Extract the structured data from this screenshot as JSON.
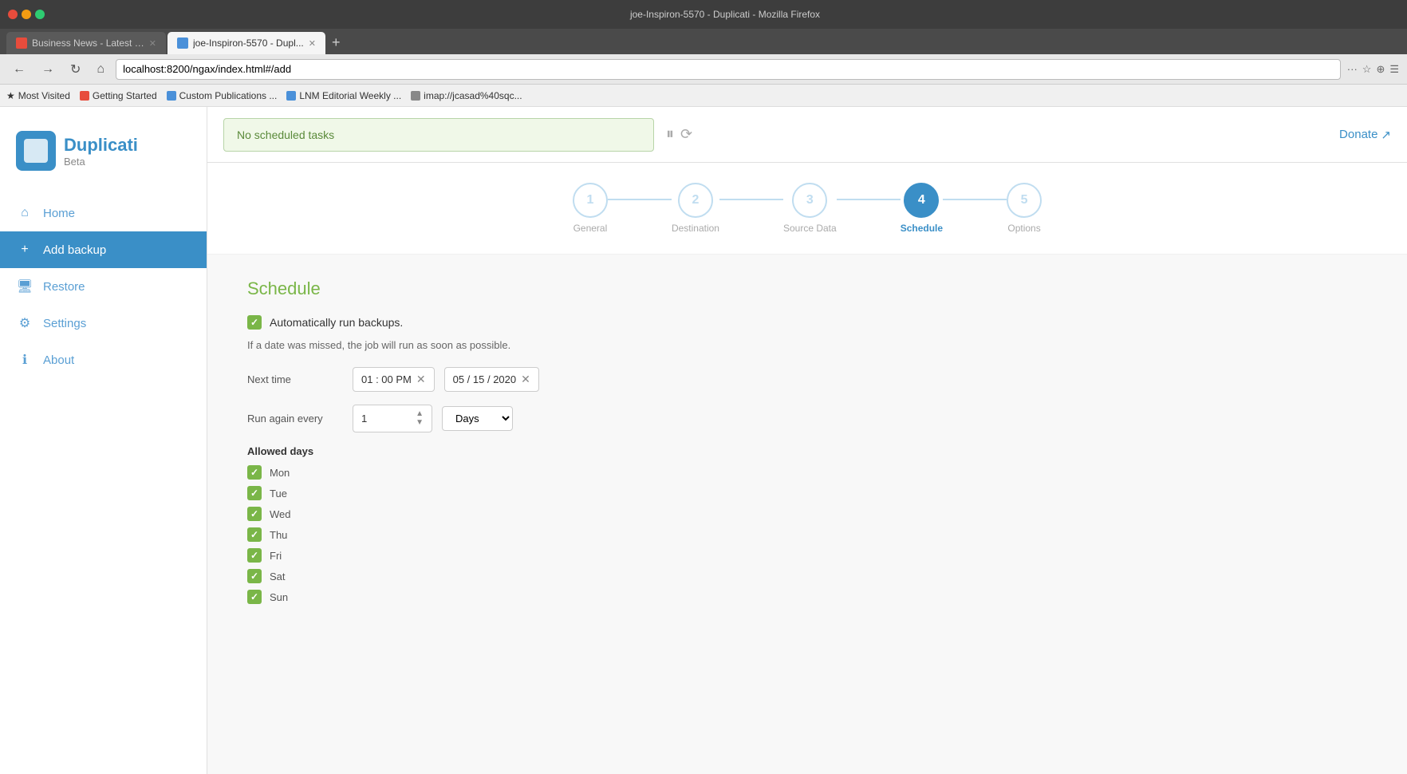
{
  "browser": {
    "title": "joe-Inspiron-5570 - Duplicati - Mozilla Firefox",
    "tabs": [
      {
        "id": "tab-1",
        "label": "Business News - Latest H...",
        "active": false,
        "favicon_color": "#e74c3c"
      },
      {
        "id": "tab-2",
        "label": "joe-Inspiron-5570 - Dupl...",
        "active": true,
        "favicon_color": "#4a90d9"
      }
    ],
    "add_tab_label": "+",
    "address": "localhost:8200/ngax/index.html#/add",
    "nav": {
      "back": "←",
      "forward": "→",
      "refresh": "↻",
      "home": "⌂"
    },
    "toolbar_icons": [
      "···",
      "☆",
      "⊕",
      "☰"
    ]
  },
  "bookmarks": [
    {
      "label": "Most Visited",
      "favicon_color": "#4a90d9",
      "icon": "★"
    },
    {
      "label": "Getting Started",
      "favicon_color": "#e74c3c"
    },
    {
      "label": "Custom Publications ...",
      "favicon_color": "#4a90d9"
    },
    {
      "label": "LNM Editorial Weekly ...",
      "favicon_color": "#4a90d9"
    },
    {
      "label": "imap://jcasad%40sqc...",
      "favicon_color": "#888"
    }
  ],
  "app": {
    "logo": {
      "name": "Duplicati",
      "sub": "Beta"
    },
    "nav_items": [
      {
        "id": "home",
        "label": "Home",
        "icon": "⌂",
        "active": false
      },
      {
        "id": "add-backup",
        "label": "Add backup",
        "icon": "+",
        "active": true
      },
      {
        "id": "restore",
        "label": "Restore",
        "icon": "🖥",
        "active": false
      },
      {
        "id": "settings",
        "label": "Settings",
        "icon": "⚙",
        "active": false
      },
      {
        "id": "about",
        "label": "About",
        "icon": "ℹ",
        "active": false
      }
    ],
    "header": {
      "status_message": "No scheduled tasks",
      "pause_icon": "⏸",
      "spinner_icon": "⟳",
      "donate_label": "Donate",
      "donate_icon": "↗"
    },
    "wizard": {
      "steps": [
        {
          "number": "1",
          "label": "General",
          "active": false
        },
        {
          "number": "2",
          "label": "Destination",
          "active": false
        },
        {
          "number": "3",
          "label": "Source Data",
          "active": false
        },
        {
          "number": "4",
          "label": "Schedule",
          "active": true
        },
        {
          "number": "5",
          "label": "Options",
          "active": false
        }
      ]
    },
    "schedule": {
      "title": "Schedule",
      "auto_backup_label": "Automatically run backups.",
      "missed_job_text": "If a date was missed, the job will run as soon as possible.",
      "next_time_label": "Next time",
      "time_value": "01 : 00  PM",
      "date_value": "05 / 15 / 2020",
      "run_again_label": "Run again every",
      "interval_value": "1",
      "interval_unit": "Days",
      "allowed_days_title": "Allowed days",
      "days": [
        {
          "id": "mon",
          "label": "Mon",
          "checked": true
        },
        {
          "id": "tue",
          "label": "Tue",
          "checked": true
        },
        {
          "id": "wed",
          "label": "Wed",
          "checked": true
        },
        {
          "id": "thu",
          "label": "Thu",
          "checked": true
        },
        {
          "id": "fri",
          "label": "Fri",
          "checked": true
        },
        {
          "id": "sat",
          "label": "Sat",
          "checked": true
        },
        {
          "id": "sun",
          "label": "Sun",
          "checked": true
        }
      ]
    }
  }
}
